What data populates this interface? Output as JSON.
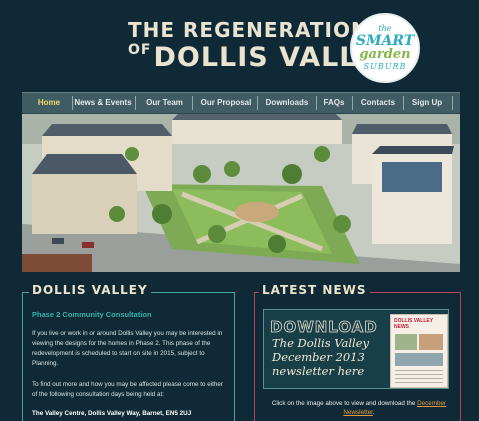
{
  "header": {
    "title_line1": "THE REGENERATION",
    "title_of": "OF",
    "title_line2": "DOLLIS VALLEY",
    "badge": {
      "the": "the",
      "smart": "SMART",
      "garden": "garden",
      "suburb": "SUBURB"
    }
  },
  "nav": {
    "items": [
      {
        "label": "Home",
        "active": true
      },
      {
        "label": "News & Events"
      },
      {
        "label": "Our Team"
      },
      {
        "label": "Our Proposal"
      },
      {
        "label": "Downloads"
      },
      {
        "label": "FAQs"
      },
      {
        "label": "Contacts"
      },
      {
        "label": "Sign Up"
      }
    ]
  },
  "left_panel": {
    "heading": "DOLLIS VALLEY",
    "subheading": "Phase 2 Community Consultation",
    "para1": "If you live or work in or around Dollis Valley you may be interested in viewing the designs for the homes in Phase 2. This phase of the redevelopment is scheduled to start on site in 2015, subject to Planning.",
    "para2": "To find out more and how you may be affected please come to either of the following consultation days being held at:",
    "address": "The Valley Centre, Dollis Valley Way, Barnet, EN5 2UJ"
  },
  "right_panel": {
    "heading": "LATEST NEWS",
    "download": "DOWNLOAD",
    "line1": "The Dollis Valley",
    "line2": "December 2013",
    "line3": "newsletter here",
    "newsletter_title": "DOLLIS VALLEY NEWS",
    "caption_pre": "Click on the image above to view and download the",
    "caption_link": "December Newsletter",
    "caption_post": "."
  },
  "colors": {
    "background": "#0f2a36",
    "nav": "#3f5b63",
    "active_nav": "#f0d66c",
    "teal_accent": "#36b0a8",
    "red_accent": "#b9405a"
  }
}
